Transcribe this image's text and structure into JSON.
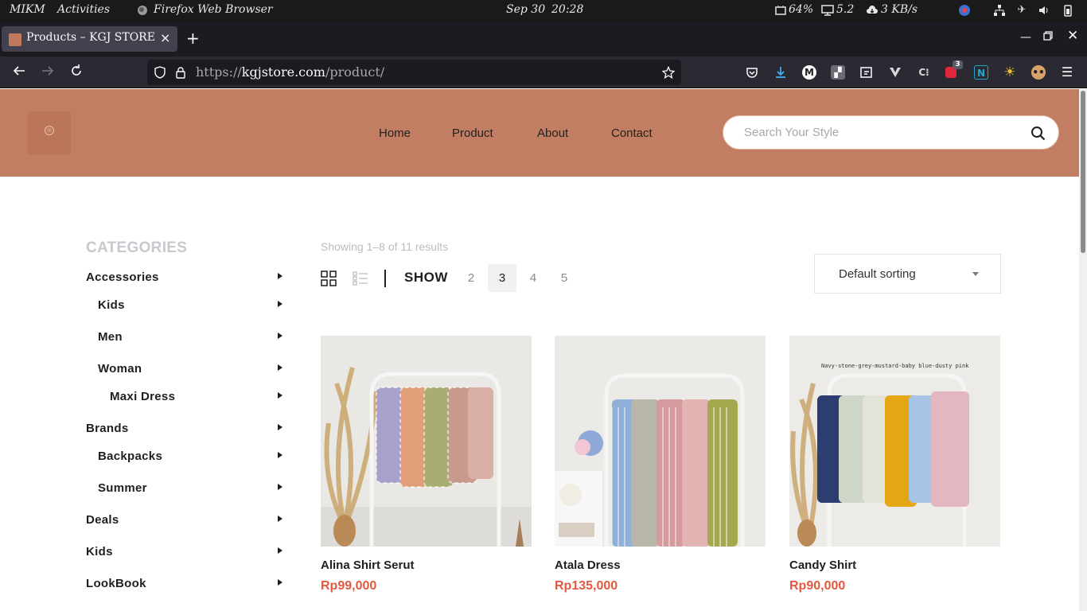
{
  "system_bar": {
    "user": "MIKM",
    "activities": "Activities",
    "app_name": "Firefox Web Browser",
    "date": "Sep 30",
    "time": "20:28",
    "battery": "64%",
    "display_value": "5.2",
    "network_speed": "3 KB/s"
  },
  "browser": {
    "tab_title": "Products – KGJ STORE",
    "url_scheme": "https://",
    "url_host": "kgjstore.com",
    "url_path": "/product/",
    "extension_badge": "3",
    "colors": {
      "tab_bar": "#1c1b22",
      "nav_bar": "#2b2a33",
      "active_tab": "#42414d"
    }
  },
  "site": {
    "colors": {
      "header": "#c17e62",
      "price": "#e2593f"
    },
    "nav": [
      "Home",
      "Product",
      "About",
      "Contact"
    ],
    "search_placeholder": "Search Your Style",
    "sidebar": {
      "heading": "CATEGORIES",
      "items": [
        {
          "label": "Accessories",
          "level": 0
        },
        {
          "label": "Kids",
          "level": 1
        },
        {
          "label": "Men",
          "level": 1
        },
        {
          "label": "Woman",
          "level": 1
        },
        {
          "label": "Maxi Dress",
          "level": 2
        },
        {
          "label": "Brands",
          "level": 0
        },
        {
          "label": "Backpacks",
          "level": 1
        },
        {
          "label": "Summer",
          "level": 1
        },
        {
          "label": "Deals",
          "level": 0
        },
        {
          "label": "Kids",
          "level": 0
        },
        {
          "label": "LookBook",
          "level": 0
        }
      ]
    },
    "shop": {
      "results_text": "Showing 1–8 of 11 results",
      "show_label": "SHOW",
      "show_options": [
        "2",
        "3",
        "4",
        "5"
      ],
      "show_selected": "3",
      "sort_selected": "Default sorting",
      "products": [
        {
          "name": "Alina Shirt Serut",
          "price": "Rp99,000",
          "image": "checked-shirts-on-rack"
        },
        {
          "name": "Atala Dress",
          "price": "Rp135,000",
          "image": "striped-dresses-on-rack"
        },
        {
          "name": "Candy Shirt",
          "price": "Rp90,000",
          "image": "solid-shirts-on-rack",
          "image_caption": "Navy-stone-grey-mustard-baby blue-dusty pink"
        }
      ]
    }
  }
}
